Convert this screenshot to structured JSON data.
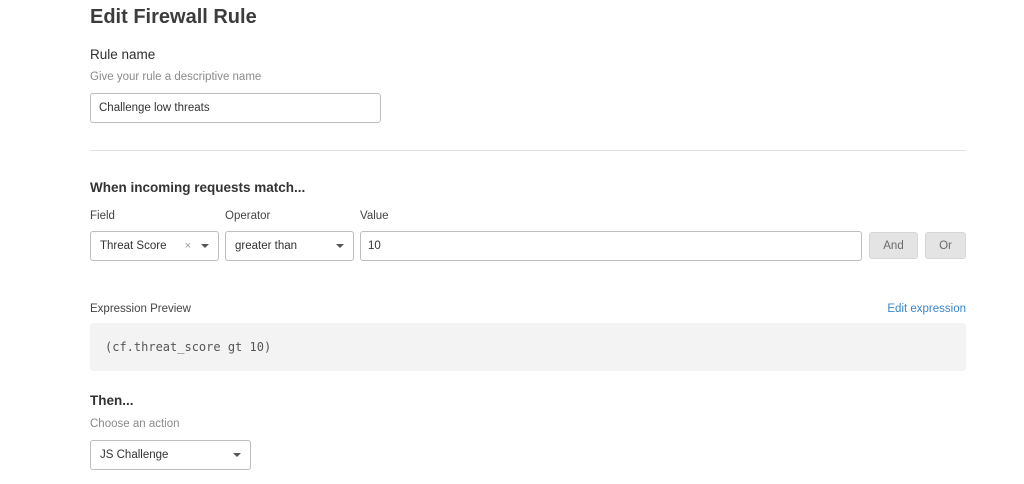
{
  "page": {
    "title": "Edit Firewall Rule"
  },
  "rule_name": {
    "label": "Rule name",
    "hint": "Give your rule a descriptive name",
    "value": "Challenge low threats"
  },
  "match": {
    "heading": "When incoming requests match...",
    "field_label": "Field",
    "operator_label": "Operator",
    "value_label": "Value",
    "field_value": "Threat Score",
    "clear_symbol": "×",
    "operator_value": "greater than",
    "value_value": "10",
    "and_label": "And",
    "or_label": "Or"
  },
  "expression": {
    "label": "Expression Preview",
    "edit_link": "Edit expression",
    "code": "(cf.threat_score gt 10)"
  },
  "then": {
    "heading": "Then...",
    "hint": "Choose an action",
    "action_value": "JS Challenge"
  },
  "icons": {
    "dropdown": "chevron-down-icon",
    "clear": "clear-icon"
  },
  "colors": {
    "link": "#3a86c8",
    "button_bg": "#e4e4e4",
    "expression_bg": "#f3f3f3"
  }
}
